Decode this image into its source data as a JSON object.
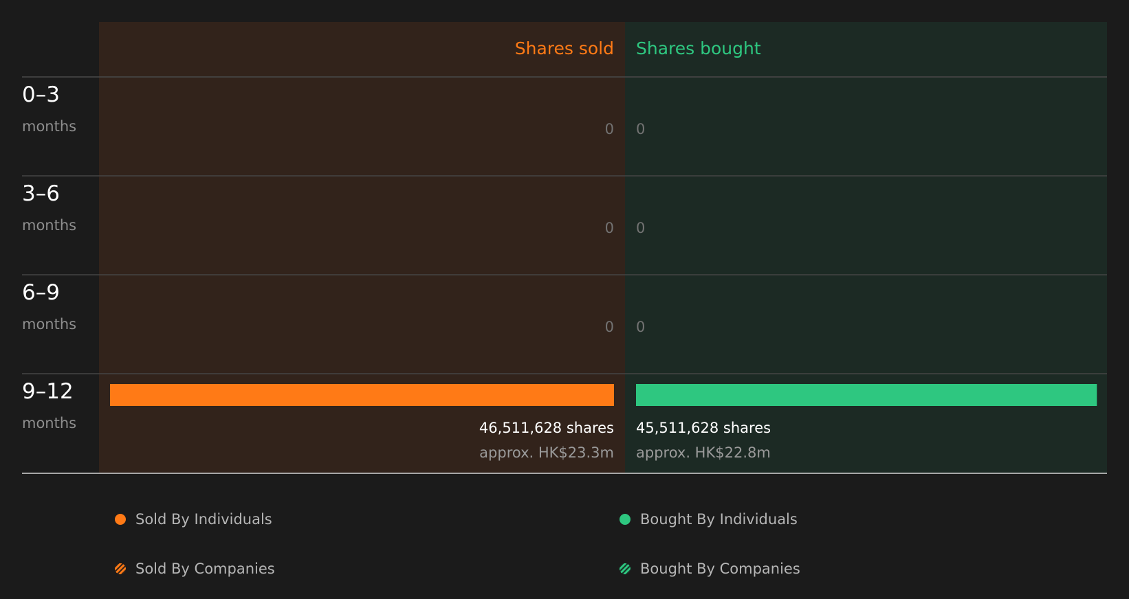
{
  "colors": {
    "background": "#1b1b1b",
    "sold_panel": "#32231b",
    "bought_panel": "#1c2a24",
    "sold": "#ff7a16",
    "bought": "#2ec780",
    "row_label": "#ffffff",
    "sub_label": "#8e8e8e",
    "zero_text": "#737373",
    "value_text": "#ffffff",
    "approx_text": "#9a9a9a",
    "divider": "#444444",
    "axis_line": "#a7a7a7",
    "legend_text": "#b6b6b6"
  },
  "chart_data": {
    "type": "bar",
    "headers": {
      "sold": "Shares sold",
      "bought": "Shares bought"
    },
    "rows": [
      {
        "period": "0–3",
        "unit": "months",
        "sold": 0,
        "bought": 0,
        "sold_text": "0",
        "bought_text": "0"
      },
      {
        "period": "3–6",
        "unit": "months",
        "sold": 0,
        "bought": 0,
        "sold_text": "0",
        "bought_text": "0"
      },
      {
        "period": "6–9",
        "unit": "months",
        "sold": 0,
        "bought": 0,
        "sold_text": "0",
        "bought_text": "0"
      },
      {
        "period": "9–12",
        "unit": "months",
        "sold": 46511628,
        "bought": 45511628,
        "sold_text": "46,511,628 shares",
        "bought_text": "45,511,628 shares",
        "sold_approx": "approx. HK$23.3m",
        "bought_approx": "approx. HK$22.8m"
      }
    ],
    "max_value": 46511628
  },
  "legend": {
    "items": [
      {
        "label": "Sold By Individuals",
        "style": "dot",
        "color": "#ff7a16"
      },
      {
        "label": "Bought By Individuals",
        "style": "dot",
        "color": "#2ec780"
      },
      {
        "label": "Sold By Companies",
        "style": "hatch",
        "color": "#ff7a16"
      },
      {
        "label": "Bought By Companies",
        "style": "hatch",
        "color": "#2ec780"
      }
    ]
  }
}
